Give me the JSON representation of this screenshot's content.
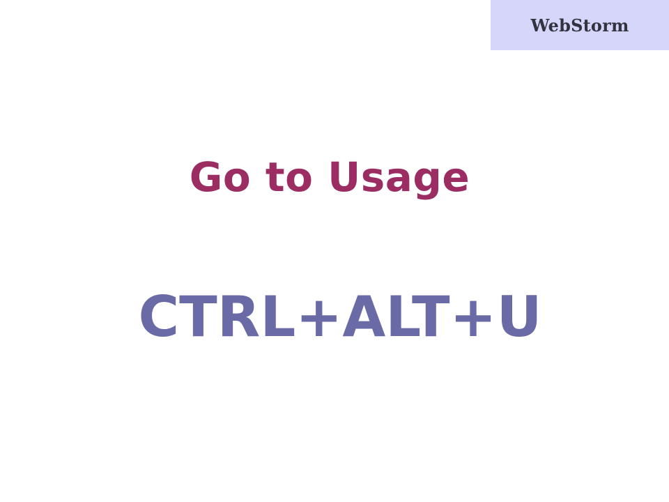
{
  "brand": {
    "label": "WebStorm",
    "background": "#d6d6fb",
    "text_color": "#333340"
  },
  "slide": {
    "title": "Go to Usage",
    "title_color": "#9b2d63",
    "shortcut": "CTRL+ALT+U",
    "shortcut_color": "#6a6aa6"
  }
}
